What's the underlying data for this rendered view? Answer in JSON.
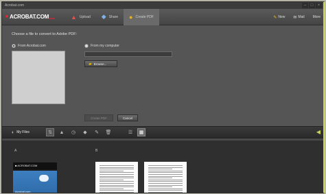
{
  "window": {
    "title": "Acrobat.com"
  },
  "window_controls": [
    "–",
    "□",
    "×"
  ],
  "toolbar": {
    "logo_text": "ACROBAT.COM",
    "logo_badge": "beta",
    "tabs": [
      {
        "label": "Upload",
        "icon": "upload-icon"
      },
      {
        "label": "Share",
        "icon": "share-icon"
      },
      {
        "label": "Create PDF",
        "icon": "create-pdf-icon",
        "active": true
      }
    ],
    "right_items": [
      {
        "label": "New",
        "icon": "pencil-icon"
      },
      {
        "label": "Mail",
        "icon": "mail-icon"
      },
      {
        "label": "More",
        "icon": ""
      }
    ]
  },
  "create_pdf": {
    "prompt": "Choose a file to convert to Adobe PDF:",
    "option_acrobat": "From Acrobat.com",
    "option_computer": "From my computer",
    "path_value": "",
    "browse_label": "Browse...",
    "convert_label": "Create PDF",
    "cancel_label": "Cancel"
  },
  "files_bar": {
    "title": "My Files",
    "sort_icons": [
      "sort-az-icon",
      "sort-type-icon",
      "sort-time-icon",
      "sort-shared-icon",
      "sort-owner-icon",
      "trash-icon"
    ],
    "view_icons": [
      "list-view-icon",
      "grid-view-icon"
    ]
  },
  "files": {
    "groups": [
      {
        "label": "A"
      },
      {
        "label": "B"
      }
    ],
    "acrobat_thumb_header": "■ ACROBAT.COM",
    "acrobat_thumb_caption": "Acrobat.com"
  },
  "colors": {
    "accent": "#c8d25a",
    "active_tab": "#6a6a6a",
    "folder": "#f3c000"
  }
}
